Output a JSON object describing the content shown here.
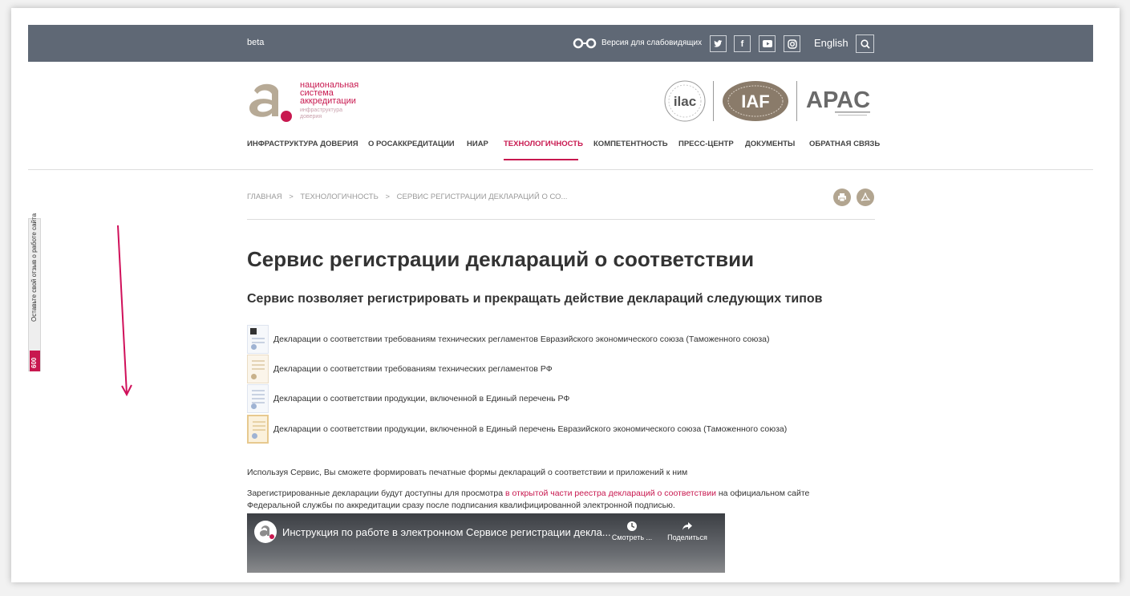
{
  "topbar": {
    "beta": "beta",
    "vision_label": "Версия для слабовидящих",
    "social": [
      "twitter-icon",
      "facebook-icon",
      "youtube-icon",
      "instagram-icon"
    ],
    "language": "English"
  },
  "logo": {
    "line1": "национальная",
    "line2": "система",
    "line3": "аккредитации",
    "sub1": "инфраструктура",
    "sub2": "доверия"
  },
  "partners": {
    "ilac": "ilac",
    "iaf": "IAF",
    "apac": "APAC"
  },
  "nav": [
    "ИНФРАСТРУКТУРА ДОВЕРИЯ",
    "О РОСАККРЕДИТАЦИИ",
    "НИАР",
    "ТЕХНОЛОГИЧНОСТЬ",
    "КОМПЕТЕНТНОСТЬ",
    "ПРЕСС-ЦЕНТР",
    "ДОКУМЕНТЫ",
    "ОБРАТНАЯ СВЯЗЬ"
  ],
  "breadcrumb": {
    "home": "ГЛАВНАЯ",
    "section": "ТЕХНОЛОГИЧНОСТЬ",
    "current": "СЕРВИС РЕГИСТРАЦИИ ДЕКЛАРАЦИЙ О СО...",
    "separator": ">"
  },
  "page": {
    "title": "Сервис регистрации деклараций о соответствии",
    "subtitle": "Сервис позволяет регистрировать и прекращать действие деклараций следующих типов",
    "declarations": [
      "Декларации о соответствии требованиям технических регламентов Евразийского экономического союза (Таможенного союза)",
      "Декларации о соответствии требованиям технических регламентов РФ",
      "Декларации о соответствии продукции, включенной в Единый перечень РФ",
      "Декларации о соответствии продукции, включенной в Единый перечень Евразийского экономического союза (Таможенного союза)"
    ],
    "para1": "Используя Сервис, Вы сможете формировать печатные формы деклараций о соответствии и приложений к ним",
    "para2_before": "Зарегистрированные декларации будут доступны для просмотра ",
    "para2_link": "в открытой части реестра деклараций о соответствии",
    "para2_after": " на официальном сайте",
    "para2_line2": "Федеральной службы по аккредитации сразу после подписания квалифицированной электронной подписью."
  },
  "video": {
    "title": "Инструкция по работе в электронном Сервисе регистрации декла...",
    "watch_later": "Смотреть ...",
    "share": "Поделиться"
  },
  "feedback": {
    "text": "Оставьте свой отзыв о работе сайта",
    "badge": "600"
  },
  "colors": {
    "accent": "#c8184f",
    "topbar": "#5f6875"
  }
}
